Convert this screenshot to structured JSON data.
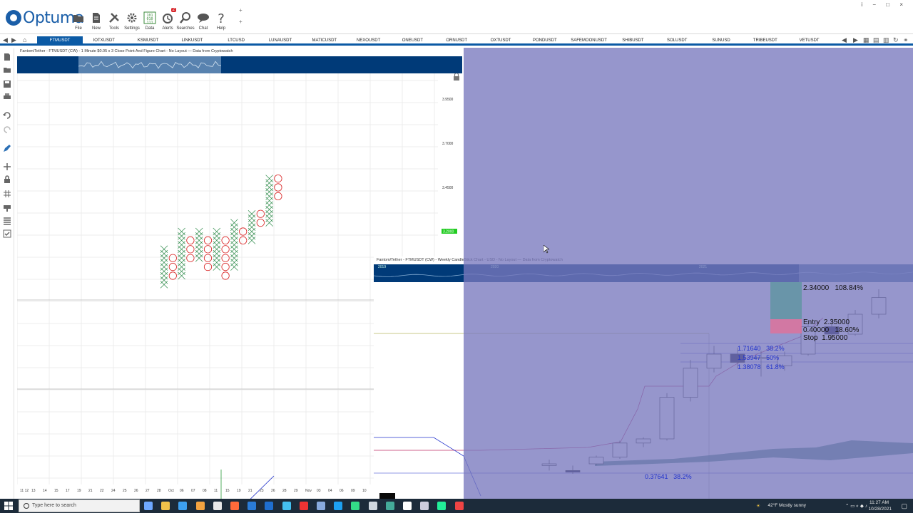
{
  "app": {
    "name": "Optuma"
  },
  "toolbar": {
    "buttons": [
      {
        "id": "file",
        "label": "File"
      },
      {
        "id": "new",
        "label": "New"
      },
      {
        "id": "tools",
        "label": "Tools"
      },
      {
        "id": "settings",
        "label": "Settings"
      },
      {
        "id": "data",
        "label": "Data"
      },
      {
        "id": "alerts",
        "label": "Alerts",
        "badge": "2"
      },
      {
        "id": "searches",
        "label": "Searches"
      },
      {
        "id": "chat",
        "label": "Chat"
      },
      {
        "id": "help",
        "label": "Help"
      }
    ],
    "window_controls": "i − □ ×"
  },
  "tabs": [
    "FTMUSDT",
    "IOTXUSDT",
    "KSMUSDT",
    "LINKUSDT",
    "LTCUSD",
    "LUNAUSDT",
    "MATICUSDT",
    "NEXOUSDT",
    "ONEUSDT",
    "ORNUSDT",
    "OXTUSDT",
    "PONDUSDT",
    "SAFEMOONUSDT",
    "SHIBUSDT",
    "SOLUSDT",
    "SUNUSD",
    "TRIBEUSDT",
    "VETUSDT"
  ],
  "active_tab": "FTMUSDT",
  "pf_chart": {
    "title": "Fantom/Tether - FTMUSDT (CW) - 1 Minute $0.05 x 3 Close Point And Figure Chart - No Layout — Data from Cryptowatch",
    "price_labels": [
      "3.9500",
      "3.7000",
      "3.4500"
    ],
    "current_price": "3.2000",
    "date_labels": [
      "11 12",
      "13",
      "14",
      "15",
      "17",
      "19",
      "21",
      "22",
      "24",
      "25",
      "26",
      "27",
      "28",
      "Oct",
      "06",
      "07",
      "08",
      "11",
      "15",
      "19",
      "21",
      "23",
      "26",
      "28",
      "29",
      "Nov",
      "03",
      "04",
      "06",
      "09",
      "10"
    ],
    "chart_data": {
      "type": "point-and-figure",
      "box_size": 0.05,
      "reversal": 3,
      "columns": [
        {
          "kind": "X",
          "low": 2.9,
          "high": 3.1
        },
        {
          "kind": "O",
          "low": 2.95,
          "high": 3.05
        },
        {
          "kind": "X",
          "low": 2.95,
          "high": 3.2
        },
        {
          "kind": "O",
          "low": 3.05,
          "high": 3.15
        },
        {
          "kind": "X",
          "low": 3.05,
          "high": 3.2
        },
        {
          "kind": "O",
          "low": 3.0,
          "high": 3.15
        },
        {
          "kind": "X",
          "low": 3.0,
          "high": 3.2
        },
        {
          "kind": "O",
          "low": 2.95,
          "high": 3.15
        },
        {
          "kind": "X",
          "low": 3.0,
          "high": 3.25
        },
        {
          "kind": "O",
          "low": 3.15,
          "high": 3.2
        },
        {
          "kind": "X",
          "low": 3.15,
          "high": 3.3
        },
        {
          "kind": "O",
          "low": 3.25,
          "high": 3.3
        },
        {
          "kind": "X",
          "low": 3.25,
          "high": 3.5
        },
        {
          "kind": "O",
          "low": 3.4,
          "high": 3.5
        }
      ]
    }
  },
  "cs_chart": {
    "title": "Fantom/Tether - FTMUSDT (CW) - Weekly CandleStick Chart - USD - No Layout — Data from Cryptowatch",
    "nav_years": [
      "2019",
      "2020",
      "2021"
    ],
    "target": {
      "price": "2.34000",
      "pct": "108.84%"
    },
    "entry": {
      "label": "Entry",
      "price": "2.35000"
    },
    "risk": {
      "price": "0.40000",
      "pct": "18.60%"
    },
    "stop": {
      "label": "Stop",
      "price": "1.95000"
    },
    "fibs": [
      {
        "price": "1.71640",
        "pct": "38.2%"
      },
      {
        "price": "1.53947",
        "pct": "50%"
      },
      {
        "price": "1.38078",
        "pct": "61.8%"
      }
    ],
    "fib_low": {
      "price": "0.37641",
      "pct": "38.2%"
    },
    "chart_data": {
      "type": "candlestick",
      "candles": [
        {
          "o": 0.28,
          "h": 0.35,
          "l": 0.22,
          "c": 0.3
        },
        {
          "o": 0.22,
          "h": 0.28,
          "l": 0.18,
          "c": 0.2
        },
        {
          "o": 0.3,
          "h": 0.4,
          "l": 0.28,
          "c": 0.38
        },
        {
          "o": 0.38,
          "h": 0.58,
          "l": 0.36,
          "c": 0.55
        },
        {
          "o": 0.55,
          "h": 0.62,
          "l": 0.5,
          "c": 0.6
        },
        {
          "o": 0.6,
          "h": 1.15,
          "l": 0.58,
          "c": 1.1
        },
        {
          "o": 1.1,
          "h": 1.55,
          "l": 1.05,
          "c": 1.45
        },
        {
          "o": 1.45,
          "h": 1.72,
          "l": 1.4,
          "c": 1.62
        },
        {
          "o": 1.62,
          "h": 1.7,
          "l": 1.45,
          "c": 1.52
        },
        {
          "o": 1.58,
          "h": 1.66,
          "l": 1.35,
          "c": 1.58
        },
        {
          "o": 1.48,
          "h": 1.65,
          "l": 1.42,
          "c": 1.6
        },
        {
          "o": 1.62,
          "h": 1.98,
          "l": 1.6,
          "c": 1.95
        },
        {
          "o": 1.95,
          "h": 2.05,
          "l": 1.8,
          "c": 1.86
        },
        {
          "o": 1.86,
          "h": 2.15,
          "l": 1.84,
          "c": 2.1
        },
        {
          "o": 2.1,
          "h": 2.4,
          "l": 2.05,
          "c": 2.3
        }
      ]
    }
  },
  "taskbar": {
    "search_placeholder": "Type here to search",
    "weather": "42°F  Mostly sunny",
    "time": "11:27 AM",
    "date": "10/28/2021"
  }
}
